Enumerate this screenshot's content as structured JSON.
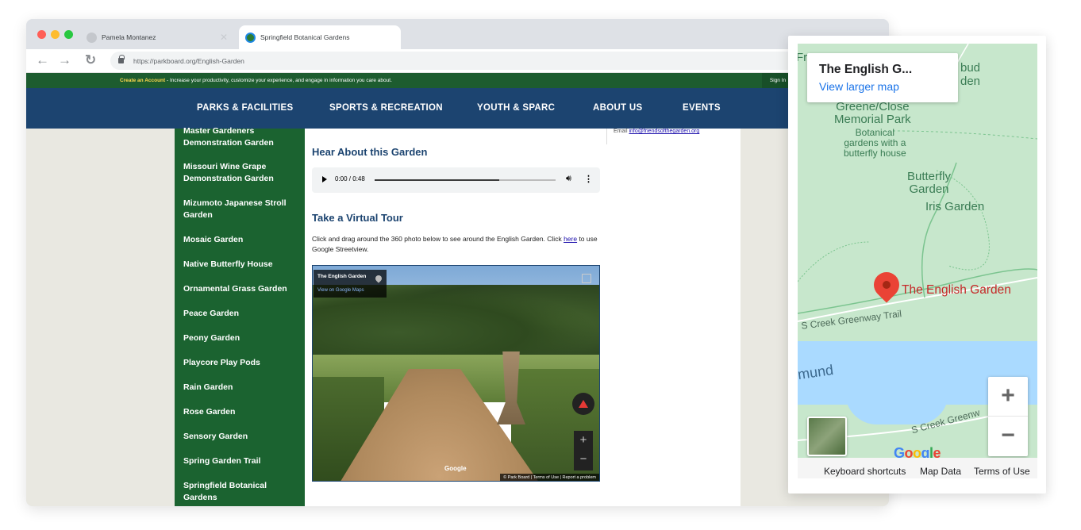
{
  "browser": {
    "tabs": [
      {
        "title": "Pamela Montanez",
        "active": false
      },
      {
        "title": "Springfield Botanical Gardens",
        "active": true
      }
    ],
    "url": "https://parkboard.org/English-Garden"
  },
  "site": {
    "account_bar": {
      "highlight": "Create an Account",
      "text": " - Increase your productivity, customize your experience, and engage in information you care about.",
      "sign_in": "Sign In"
    },
    "nav": [
      "PARKS & FACILITIES",
      "SPORTS & RECREATION",
      "YOUTH & SPARC",
      "ABOUT US",
      "EVENTS"
    ],
    "sidebar": [
      "Master Gardeners Demonstration Garden",
      "Missouri Wine Grape Demonstration Garden",
      "Mizumoto Japanese Stroll Garden",
      "Mosaic Garden",
      "Native Butterfly House",
      "Ornamental Grass Garden",
      "Peace Garden",
      "Peony Garden",
      "Playcore Play Pods",
      "Rain Garden",
      "Rose Garden",
      "Sensory Garden",
      "Spring Garden Trail",
      "Springfield Botanical Gardens"
    ],
    "email_prefix": "Email ",
    "email": "info@friendsofthegarden.org",
    "audio_section": {
      "heading": "Hear About this Garden",
      "time": "0:00 / 0:48",
      "progress": 0.69
    },
    "tour_section": {
      "heading": "Take a Virtual Tour",
      "intro_before": "Click and drag around the 360 photo below to see around the English Garden. Click ",
      "intro_link": "here",
      "intro_after": " to use Google Streetview."
    },
    "pano": {
      "title": "The English Garden",
      "link": "View on Google Maps",
      "google": "Google",
      "credits": "© Park Board | Terms of Use | Report a problem"
    }
  },
  "map": {
    "card_title": "The English G...",
    "card_link": "View larger map",
    "labels": {
      "top_left": "Fr",
      "redbud": "bud\nden",
      "greene": "Greene/Close\nMemorial Park",
      "greene_sub": "Botanical\ngardens with a\nbutterfly house",
      "butterfly": "Butterfly\nGarden",
      "iris": "Iris Garden",
      "pin_label": "The English Garden",
      "trail1": "S Creek Greenway Trail",
      "water": "mund",
      "trail2": "S Creek Greenw"
    },
    "google": [
      "G",
      "o",
      "o",
      "g",
      "l",
      "e"
    ],
    "google_colors": [
      "#4285f4",
      "#ea4335",
      "#fbbc05",
      "#4285f4",
      "#34a853",
      "#ea4335"
    ],
    "zoom_in": "+",
    "zoom_out": "−",
    "footer": [
      "Keyboard shortcuts",
      "Map Data",
      "Terms of Use"
    ]
  }
}
